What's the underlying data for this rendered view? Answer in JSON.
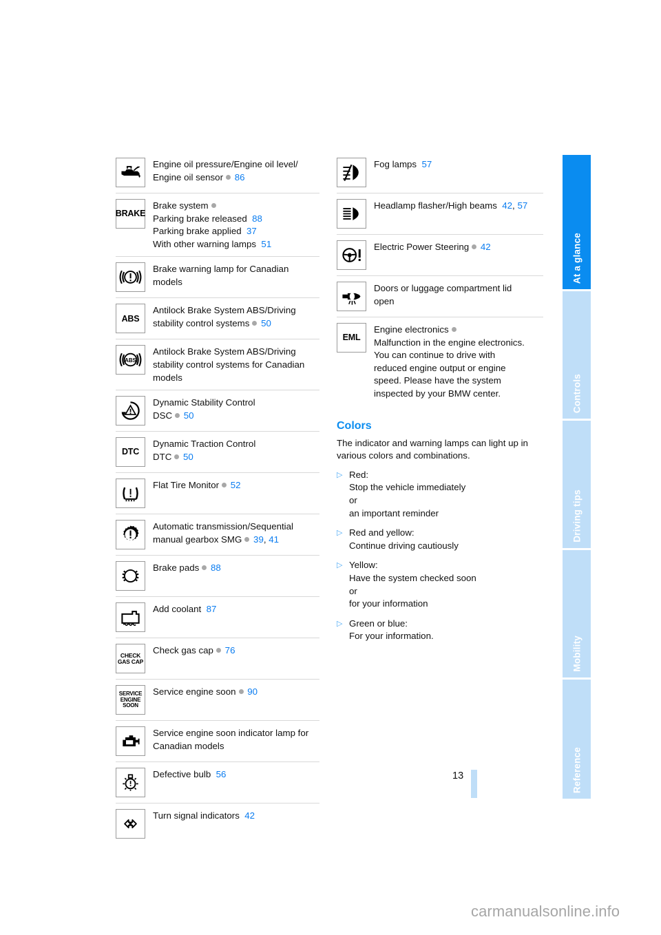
{
  "document": {
    "page_number": "13",
    "watermark": "carmanualsonline.info"
  },
  "colors": {
    "accent_blue": "#0a8cf0",
    "link_blue": "#0a7cf0",
    "tab_inactive": "#bfdef8",
    "dot_gray": "#a8a8a8"
  },
  "sidebar": {
    "tabs": [
      {
        "label": "At a glance",
        "active": true
      },
      {
        "label": "Controls",
        "active": false
      },
      {
        "label": "Driving tips",
        "active": false
      },
      {
        "label": "Mobility",
        "active": false
      },
      {
        "label": "Reference",
        "active": false
      }
    ]
  },
  "left_column": {
    "rows": [
      {
        "icon": "engine-oil-can-icon",
        "lines": [
          {
            "text": "Engine oil pressure/Engine oil level/"
          },
          {
            "text": "Engine oil sensor",
            "dot": true,
            "pages": [
              "86"
            ]
          }
        ]
      },
      {
        "icon": "brake-text-icon",
        "icon_text": "BRAKE",
        "lines": [
          {
            "text": "Brake system",
            "dot": true
          },
          {
            "text": "Parking brake released",
            "pages": [
              "88"
            ]
          },
          {
            "text": "Parking brake applied",
            "pages": [
              "37"
            ]
          },
          {
            "text": "With other warning lamps",
            "pages": [
              "51"
            ]
          }
        ]
      },
      {
        "icon": "brake-warning-canadian-icon",
        "lines": [
          {
            "text": "Brake warning lamp for Canadian"
          },
          {
            "text": "models"
          }
        ]
      },
      {
        "icon": "abs-text-icon",
        "icon_text": "ABS",
        "lines": [
          {
            "text": "Antilock Brake System ABS/Driving"
          },
          {
            "text": "stability control systems",
            "dot": true,
            "pages": [
              "50"
            ]
          }
        ]
      },
      {
        "icon": "abs-canadian-icon",
        "lines": [
          {
            "text": "Antilock Brake System ABS/Driving"
          },
          {
            "text": "stability control systems for Canadian"
          },
          {
            "text": "models"
          }
        ]
      },
      {
        "icon": "dsc-icon",
        "lines": [
          {
            "text": "Dynamic Stability Control"
          },
          {
            "text": "DSC",
            "dot": true,
            "pages": [
              "50"
            ]
          }
        ]
      },
      {
        "icon": "dtc-text-icon",
        "icon_text": "DTC",
        "lines": [
          {
            "text": "Dynamic Traction Control"
          },
          {
            "text": "DTC",
            "dot": true,
            "pages": [
              "50"
            ]
          }
        ]
      },
      {
        "icon": "flat-tire-monitor-icon",
        "lines": [
          {
            "text": "Flat Tire Monitor",
            "dot": true,
            "pages": [
              "52"
            ]
          }
        ]
      },
      {
        "icon": "transmission-gear-warning-icon",
        "lines": [
          {
            "text": "Automatic transmission/Sequential"
          },
          {
            "text": "manual gearbox SMG",
            "dot": true,
            "pages": [
              "39",
              "41"
            ]
          }
        ]
      },
      {
        "icon": "brake-pads-icon",
        "lines": [
          {
            "text": "Brake pads",
            "dot": true,
            "pages": [
              "88"
            ]
          }
        ]
      },
      {
        "icon": "add-coolant-icon",
        "lines": [
          {
            "text": "Add coolant",
            "pages": [
              "87"
            ]
          }
        ]
      },
      {
        "icon": "check-gas-cap-icon",
        "icon_text": "CHECK\nGAS CAP",
        "lines": [
          {
            "text": "Check gas cap",
            "dot": true,
            "pages": [
              "76"
            ]
          }
        ]
      },
      {
        "icon": "service-engine-soon-text-icon",
        "icon_text": "SERVICE\nENGINE\nSOON",
        "lines": [
          {
            "text": "Service engine soon",
            "dot": true,
            "pages": [
              "90"
            ]
          }
        ]
      },
      {
        "icon": "check-engine-canadian-icon",
        "lines": [
          {
            "text": "Service engine soon indicator lamp for"
          },
          {
            "text": "Canadian models"
          }
        ]
      },
      {
        "icon": "defective-bulb-icon",
        "lines": [
          {
            "text": "Defective bulb",
            "pages": [
              "56"
            ]
          }
        ]
      },
      {
        "icon": "turn-signal-indicators-icon",
        "lines": [
          {
            "text": "Turn signal indicators",
            "pages": [
              "42"
            ]
          }
        ]
      }
    ]
  },
  "right_column": {
    "rows": [
      {
        "icon": "fog-lamps-icon",
        "lines": [
          {
            "text": "Fog lamps",
            "pages": [
              "57"
            ]
          }
        ]
      },
      {
        "icon": "high-beams-icon",
        "lines": [
          {
            "text": "Headlamp flasher/High beams",
            "pages": [
              "42",
              "57"
            ]
          }
        ]
      },
      {
        "icon": "electric-power-steering-icon",
        "lines": [
          {
            "text": "Electric Power Steering",
            "dot": true,
            "pages": [
              "42"
            ]
          }
        ]
      },
      {
        "icon": "doors-luggage-open-icon",
        "lines": [
          {
            "text": "Doors or luggage compartment lid"
          },
          {
            "text": "open"
          }
        ]
      },
      {
        "icon": "eml-text-icon",
        "icon_text": "EML",
        "lines": [
          {
            "text": "Engine electronics",
            "dot": true
          },
          {
            "text": "Malfunction in the engine electronics."
          },
          {
            "text": "You can continue to drive with"
          },
          {
            "text": "reduced engine output or engine"
          },
          {
            "text": "speed. Please have the system"
          },
          {
            "text": "inspected by your BMW center."
          }
        ]
      }
    ],
    "colors_section": {
      "heading": "Colors",
      "intro": "The indicator and warning lamps can light up in various colors and combinations.",
      "bullets": [
        {
          "lines": [
            "Red:",
            "Stop the vehicle immediately",
            "or",
            "an important reminder"
          ]
        },
        {
          "lines": [
            "Red and yellow:",
            "Continue driving cautiously"
          ]
        },
        {
          "lines": [
            "Yellow:",
            "Have the system checked soon",
            "or",
            "for your information"
          ]
        },
        {
          "lines": [
            "Green or blue:",
            "For your information."
          ]
        }
      ]
    }
  }
}
